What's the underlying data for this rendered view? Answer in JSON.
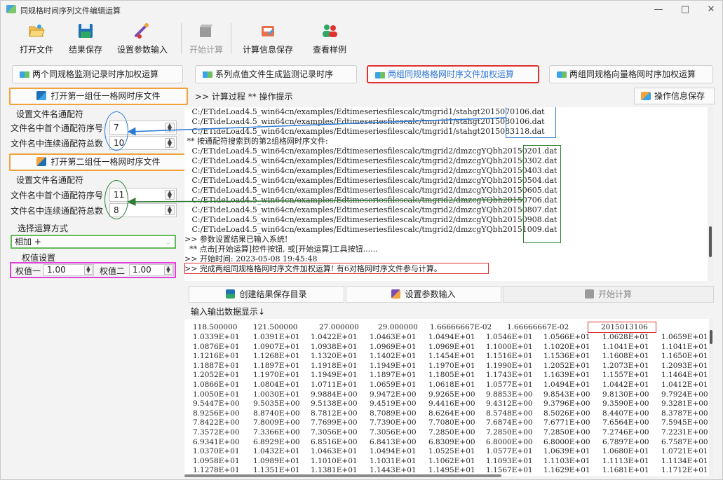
{
  "window": {
    "title": "同规格时间序列文件编辑运算",
    "controls": [
      "—",
      "□",
      "✕"
    ]
  },
  "toolbar": {
    "open_file": "打开文件",
    "save_result": "结果保存",
    "set_params": "设置参数输入",
    "start_calc": "开始计算",
    "save_calc_info": "计算信息保存",
    "view_sample": "查看样例"
  },
  "operations": [
    "两个同规格监测记录时序加权运算",
    "系列点值文件生成监测记录时序",
    "两组同规格格网时序文件加权运算",
    "两组同规格向量格网时序加权运算"
  ],
  "left": {
    "open_group1": "打开第一组任一格网时序文件",
    "set_wildcard1": "设置文件名通配符",
    "first_wildcard_label1": "文件名中首个通配符序号",
    "first_wildcard_value1": "7",
    "count_label1": "文件名中连续通配符总数",
    "count_value1": "10",
    "open_group2": "打开第二组任一格网时序文件",
    "set_wildcard2": "设置文件名通配符",
    "first_wildcard_label2": "文件名中首个通配符序号",
    "first_wildcard_value2": "11",
    "count_label2": "文件名中连续通配符总数",
    "count_value2": "8",
    "operation_mode_label": "选择运算方式",
    "operation_mode_value": "相加 +",
    "weight_section": "权值设置",
    "weight1_label": "权值一",
    "weight1_value": "1.00",
    "weight2_label": "权值二",
    "weight2_value": "1.00"
  },
  "log": {
    "header": ">> 计算过程 ** 操作提示",
    "save_info_button": "操作信息保存",
    "lines": [
      "   C:/ETideLoad4.5_win64cn/examples/Edtimeseriesfilescalc/tmgrid1/stahgt2015070106.dat",
      "   C:/ETideLoad4.5_win64cn/examples/Edtimeseriesfilescalc/tmgrid1/stahgt2015080106.dat",
      "   C:/ETideLoad4.5_win64cn/examples/Edtimeseriesfilescalc/tmgrid1/stahgt2015083118.dat",
      " ** 按通配符搜索到的第2组格网时序文件:",
      "   C:/ETideLoad4.5_win64cn/examples/Edtimeseriesfilescalc/tmgrid2/dmzcgYQbh20150201.dat",
      "   C:/ETideLoad4.5_win64cn/examples/Edtimeseriesfilescalc/tmgrid2/dmzcgYQbh20150302.dat",
      "   C:/ETideLoad4.5_win64cn/examples/Edtimeseriesfilescalc/tmgrid2/dmzcgYQbh20150403.dat",
      "   C:/ETideLoad4.5_win64cn/examples/Edtimeseriesfilescalc/tmgrid2/dmzcgYQbh20150504.dat",
      "   C:/ETideLoad4.5_win64cn/examples/Edtimeseriesfilescalc/tmgrid2/dmzcgYQbh20150605.dat",
      "   C:/ETideLoad4.5_win64cn/examples/Edtimeseriesfilescalc/tmgrid2/dmzcgYQbh20150706.dat",
      "   C:/ETideLoad4.5_win64cn/examples/Edtimeseriesfilescalc/tmgrid2/dmzcgYQbh20150807.dat",
      "   C:/ETideLoad4.5_win64cn/examples/Edtimeseriesfilescalc/tmgrid2/dmzcgYQbh20150908.dat",
      "   C:/ETideLoad4.5_win64cn/examples/Edtimeseriesfilescalc/tmgrid2/dmzcgYQbh20151009.dat",
      ">> 参数设置结果已输入系统!",
      "  ** 点击[开始运算]控件按钮, 或[开始运算]工具按钮......",
      ">> 开始时间: 2023-05-08 19:45:48",
      ">> 完成两组同规格格网时序文件加权运算! 有6对格网时序文件参与计算。"
    ]
  },
  "mid": {
    "create_dir": "创建结果保存目录",
    "set_params": "设置参数输入",
    "start_calc": "开始计算"
  },
  "output": {
    "header": "输入输出数据显示↓",
    "first_row": [
      "118.500000",
      "121.500000",
      "27.000000",
      "29.000000",
      "1.66666667E-02",
      "1.66666667E-02",
      "2015013106"
    ],
    "rows": [
      [
        "1.0339E+01",
        "1.0391E+01",
        "1.0422E+01",
        "1.0463E+01",
        "1.0494E+01",
        "1.0546E+01",
        "1.0566E+01",
        "1.0628E+01",
        "1.0659E+01"
      ],
      [
        "1.0876E+01",
        "1.0907E+01",
        "1.0938E+01",
        "1.0969E+01",
        "1.0969E+01",
        "1.1000E+01",
        "1.1020E+01",
        "1.1041E+01",
        "1.1041E+01"
      ],
      [
        "1.1216E+01",
        "1.1268E+01",
        "1.1320E+01",
        "1.1402E+01",
        "1.1454E+01",
        "1.1516E+01",
        "1.1536E+01",
        "1.1608E+01",
        "1.1650E+01"
      ],
      [
        "1.1887E+01",
        "1.1897E+01",
        "1.1918E+01",
        "1.1949E+01",
        "1.1970E+01",
        "1.1990E+01",
        "1.2052E+01",
        "1.2073E+01",
        "1.2093E+01"
      ],
      [
        "1.2052E+01",
        "1.1970E+01",
        "1.1949E+01",
        "1.1897E+01",
        "1.1805E+01",
        "1.1743E+01",
        "1.1639E+01",
        "1.1557E+01",
        "1.1464E+01"
      ],
      [
        "1.0866E+01",
        "1.0804E+01",
        "1.0711E+01",
        "1.0659E+01",
        "1.0618E+01",
        "1.0577E+01",
        "1.0494E+01",
        "1.0442E+01",
        "1.0412E+01"
      ],
      [
        "1.0050E+01",
        "1.0030E+01",
        "9.9884E+00",
        "9.9472E+00",
        "9.9265E+00",
        "9.8853E+00",
        "9.8543E+00",
        "9.8130E+00",
        "9.7924E+00"
      ],
      [
        "9.5447E+00",
        "9.5035E+00",
        "9.5138E+00",
        "9.4519E+00",
        "9.4416E+00",
        "9.4312E+00",
        "9.3796E+00",
        "9.3590E+00",
        "9.3281E+00"
      ],
      [
        "8.9256E+00",
        "8.8740E+00",
        "8.7812E+00",
        "8.7089E+00",
        "8.6264E+00",
        "8.5748E+00",
        "8.5026E+00",
        "8.4407E+00",
        "8.3787E+00"
      ],
      [
        "7.8422E+00",
        "7.8009E+00",
        "7.7699E+00",
        "7.7390E+00",
        "7.7080E+00",
        "7.6874E+00",
        "7.6771E+00",
        "7.6564E+00",
        "7.5945E+00"
      ],
      [
        "7.3572E+00",
        "7.3366E+00",
        "7.3056E+00",
        "7.3056E+00",
        "7.2850E+00",
        "7.2850E+00",
        "7.2850E+00",
        "7.2746E+00",
        "7.2231E+00"
      ],
      [
        "6.9341E+00",
        "6.8929E+00",
        "6.8516E+00",
        "6.8413E+00",
        "6.8309E+00",
        "6.8000E+00",
        "6.8000E+00",
        "6.7897E+00",
        "6.7587E+00"
      ],
      [
        "1.0370E+01",
        "1.0432E+01",
        "1.0463E+01",
        "1.0494E+01",
        "1.0525E+01",
        "1.0577E+01",
        "1.0639E+01",
        "1.0680E+01",
        "1.0721E+01"
      ],
      [
        "1.0958E+01",
        "1.0989E+01",
        "1.1010E+01",
        "1.1031E+01",
        "1.1062E+01",
        "1.1093E+01",
        "1.1103E+01",
        "1.1113E+01",
        "1.1134E+01"
      ],
      [
        "1.1278E+01",
        "1.1351E+01",
        "1.1381E+01",
        "1.1443E+01",
        "1.1495E+01",
        "1.1567E+01",
        "1.1629E+01",
        "1.1681E+01",
        "1.1712E+01"
      ]
    ]
  },
  "colors": {
    "blue_mark": "#2b7bd6",
    "green_mark": "#2e7d32",
    "red_mark": "#e0312f",
    "orange_mark": "#f0a23b",
    "magenta_mark": "#e040d8",
    "light_green_mark": "#62b958"
  }
}
